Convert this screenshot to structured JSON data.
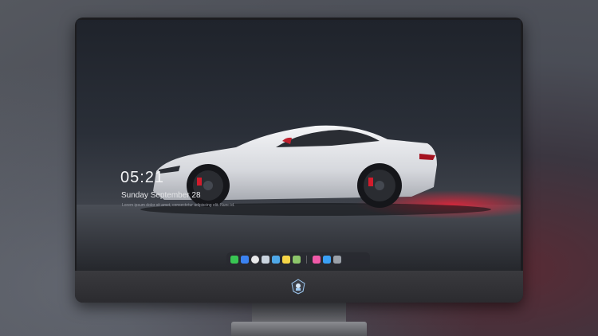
{
  "lockscreen": {
    "time": "05:21",
    "date": "Sunday September  28",
    "note": "Lorem ipsum dolor sit amet, consectetur adipiscing elit. Nunc id."
  },
  "dock": {
    "apps_left": [
      {
        "icon": "messages-icon",
        "color": "#39c553"
      },
      {
        "icon": "finder-icon",
        "color": "#3b82f0"
      },
      {
        "icon": "safari-icon",
        "color": "#e8e8ea"
      },
      {
        "icon": "preview-icon",
        "color": "#c9d3de"
      },
      {
        "icon": "clapper-icon",
        "color": "#4fa8e8"
      },
      {
        "icon": "notes-icon",
        "color": "#f5d547"
      },
      {
        "icon": "photos-icon",
        "color": "#8cc56a"
      }
    ],
    "apps_right": [
      {
        "icon": "music-icon",
        "color": "#f05aa8"
      },
      {
        "icon": "app-store-icon",
        "color": "#3aa0f5"
      },
      {
        "icon": "trash-icon",
        "color": "#9aa0a8"
      }
    ]
  },
  "colors": {
    "accent_light": "#e0253a",
    "car_body": "#e4e6ea",
    "caliper": "#d21c2c"
  }
}
